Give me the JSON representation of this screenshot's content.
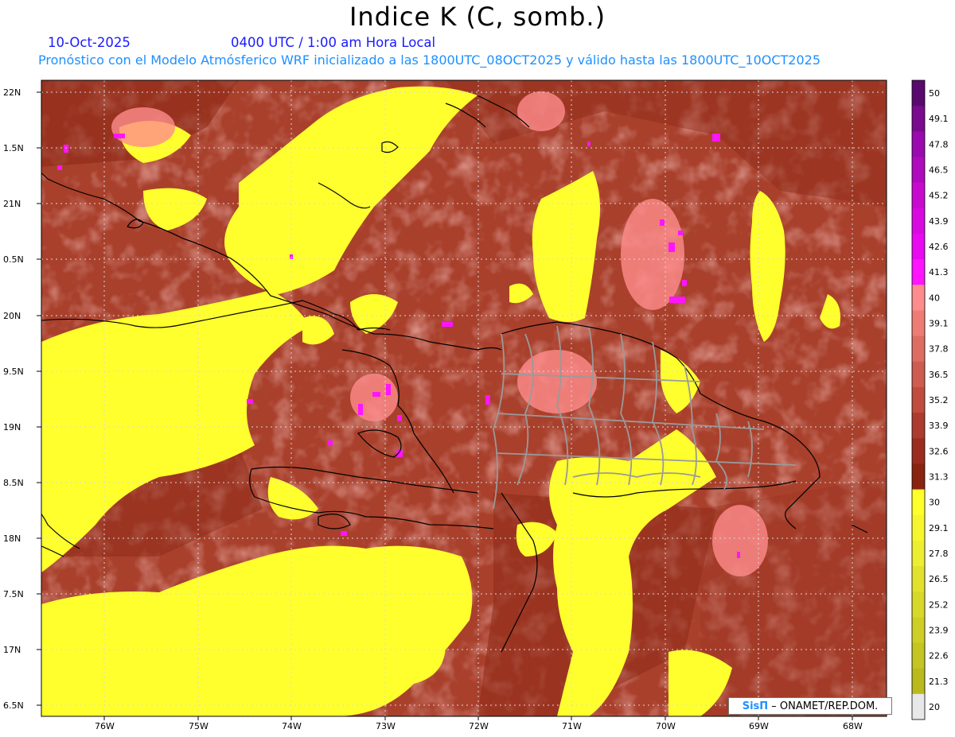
{
  "header": {
    "title": "Indice K (C, somb.)",
    "date": "10-Oct-2025",
    "time": "0400 UTC / 1:00 am Hora Local",
    "description": "Pronóstico con el Modelo Atmósferico WRF inicializado a las 1800UTC_08OCT2025 y válido hasta las  1800UTC_10OCT2025"
  },
  "axes": {
    "lat_labels": [
      "22N",
      "1.5N",
      "21N",
      "0.5N",
      "20N",
      "9.5N",
      "19N",
      "8.5N",
      "18N",
      "7.5N",
      "17N",
      "6.5N"
    ],
    "lon_labels": [
      "76W",
      "75W",
      "74W",
      "73W",
      "72W",
      "71W",
      "70W",
      "69W",
      "68W"
    ],
    "lat_range": [
      16.4,
      22.2
    ],
    "lon_range": [
      -76.6,
      -67.6
    ],
    "grid": true
  },
  "colorbar": {
    "levels": [
      "50",
      "49.1",
      "47.8",
      "46.5",
      "45.2",
      "43.9",
      "42.6",
      "41.3",
      "40",
      "39.1",
      "37.8",
      "36.5",
      "35.2",
      "33.9",
      "32.6",
      "31.3",
      "30",
      "29.1",
      "27.8",
      "26.5",
      "25.2",
      "23.9",
      "22.6",
      "21.3",
      "20"
    ],
    "colors": [
      "#5a0a6e",
      "#7a0a8e",
      "#9a0aae",
      "#b00abe",
      "#c80ad0",
      "#d80ae0",
      "#e80af0",
      "#ff14ff",
      "#ff8c8c",
      "#ef7c74",
      "#df6c62",
      "#cf5c50",
      "#bf4c3e",
      "#ad3c2e",
      "#9b2c1e",
      "#8a2410",
      "#ffff2a",
      "#f6f62e",
      "#eded32",
      "#e2e22e",
      "#d8d82a",
      "#cece26",
      "#c4c422",
      "#baba1e",
      "#e8e8e8"
    ]
  },
  "credit": {
    "brand": "SisΠ",
    "org": " – ONAMET/REP.DOM."
  }
}
